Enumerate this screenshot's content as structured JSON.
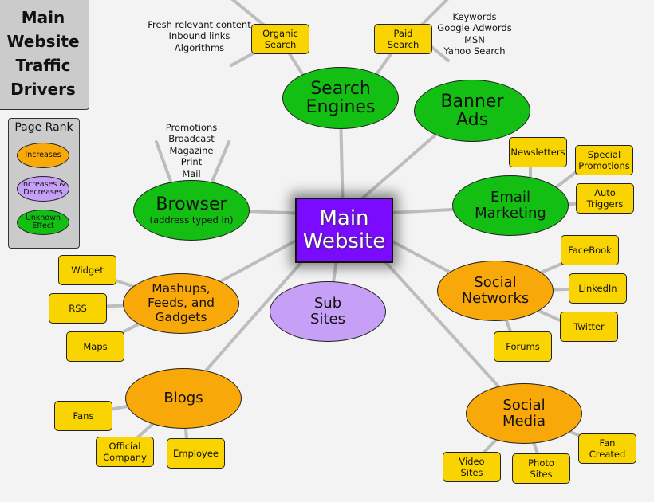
{
  "title": {
    "lines": [
      "Main",
      "Website",
      "Traffic",
      "Drivers"
    ]
  },
  "legend": {
    "title": "Page Rank",
    "items": [
      {
        "label": "Increases",
        "color": "#f9a80a"
      },
      {
        "label": "Increases & Decreases",
        "color": "#c6a0f7"
      },
      {
        "label": "Unknown Effect",
        "color": "#12bf12"
      }
    ]
  },
  "center": {
    "label_lines": [
      "Main",
      "Website"
    ],
    "color": "#7a0bff"
  },
  "hubs": {
    "search_engines": {
      "lines": [
        "Search",
        "Engines"
      ]
    },
    "banner_ads": {
      "lines": [
        "Banner",
        "Ads"
      ]
    },
    "browser": {
      "title": "Browser",
      "subtitle": "(address typed in)"
    },
    "email_marketing": {
      "lines": [
        "Email",
        "Marketing"
      ]
    },
    "social_networks": {
      "lines": [
        "Social",
        "Networks"
      ]
    },
    "sub_sites": {
      "lines": [
        "Sub",
        "Sites"
      ]
    },
    "mashups": {
      "lines": [
        "Mashups,",
        "Feeds, and",
        "Gadgets"
      ]
    },
    "blogs": {
      "lines": [
        "Blogs"
      ]
    },
    "social_media": {
      "lines": [
        "Social",
        "Media"
      ]
    }
  },
  "boxes": {
    "organic_search": [
      "Organic",
      "Search"
    ],
    "paid_search": [
      "Paid",
      "Search"
    ],
    "newsletters": [
      "Newsletters"
    ],
    "special_promotions": [
      "Special",
      "Promotions"
    ],
    "auto_triggers": [
      "Auto",
      "Triggers"
    ],
    "facebook": [
      "FaceBook"
    ],
    "linkedin": [
      "LinkedIn"
    ],
    "twitter": [
      "Twitter"
    ],
    "forums": [
      "Forums"
    ],
    "widget": [
      "Widget"
    ],
    "rss": [
      "RSS"
    ],
    "maps": [
      "Maps"
    ],
    "fans": [
      "Fans"
    ],
    "official_company": [
      "Official",
      "Company"
    ],
    "employee": [
      "Employee"
    ],
    "video_sites": [
      "Video",
      "Sites"
    ],
    "photo_sites": [
      "Photo",
      "Sites"
    ],
    "fan_created": [
      "Fan",
      "Created"
    ]
  },
  "notes": {
    "organic": [
      "Fresh relevant content",
      "Inbound links",
      "Algorithms"
    ],
    "paid": [
      "Keywords",
      "Google Adwords",
      "MSN",
      "Yahoo Search"
    ],
    "browser": [
      "Promotions",
      "Broadcast",
      "Magazine",
      "Print",
      "Mail"
    ]
  }
}
